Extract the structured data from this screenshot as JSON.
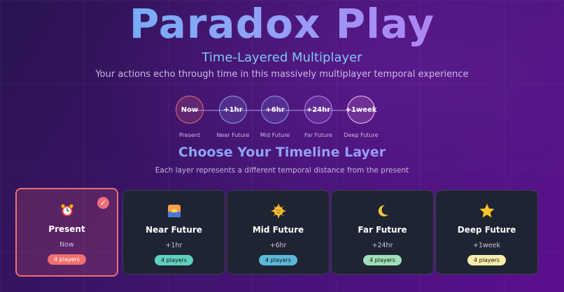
{
  "header": {
    "title": "Paradox Play",
    "subtitle": "Time-Layered Multiplayer",
    "tagline": "Your actions echo through time in this massively multiplayer temporal experience"
  },
  "timeline": [
    {
      "label": "Now",
      "caption": "Present",
      "color": "#ef6e78"
    },
    {
      "label": "+1hr",
      "caption": "Near Future",
      "color": "#8ea0f0"
    },
    {
      "label": "+6hr",
      "caption": "Mid Future",
      "color": "#8ea0f0"
    },
    {
      "label": "+24hr",
      "caption": "Far Future",
      "color": "#b58de8"
    },
    {
      "label": "+1week",
      "caption": "Deep Future",
      "color": "#f0c8f0"
    }
  ],
  "section": {
    "title": "Choose Your Timeline Layer",
    "subtitle": "Each layer represents a different temporal distance from the present"
  },
  "layers": [
    {
      "name": "Present",
      "offset": "Now",
      "players": "4 players",
      "icon": "alarm-clock-icon",
      "badge_color": "#f07070",
      "selected": true
    },
    {
      "name": "Near Future",
      "offset": "+1hr",
      "players": "4 players",
      "icon": "sunrise-icon",
      "badge_color": "#5fd0c0",
      "selected": false
    },
    {
      "name": "Mid Future",
      "offset": "+6hr",
      "players": "4 players",
      "icon": "sun-face-icon",
      "badge_color": "#5bb8d8",
      "selected": false
    },
    {
      "name": "Far Future",
      "offset": "+24hr",
      "players": "4 players",
      "icon": "crescent-moon-icon",
      "badge_color": "#9fe0b8",
      "selected": false
    },
    {
      "name": "Deep Future",
      "offset": "+1week",
      "players": "4 players",
      "icon": "star-icon",
      "badge_color": "#f8ecaa",
      "selected": false
    }
  ]
}
